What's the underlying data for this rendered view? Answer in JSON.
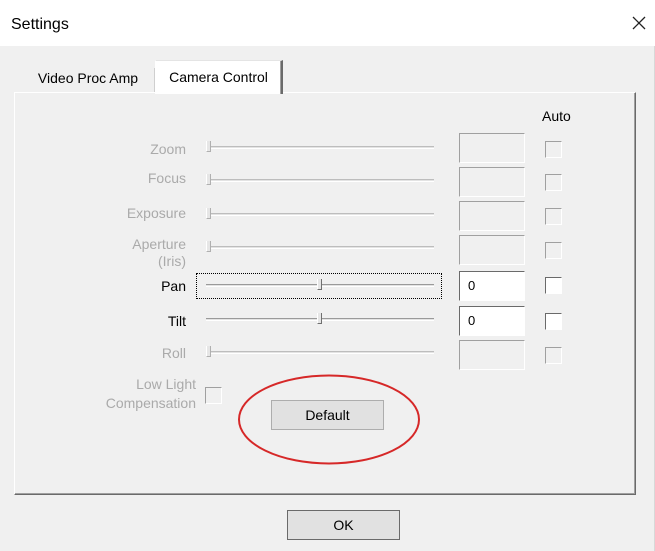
{
  "window": {
    "title": "Settings"
  },
  "tabs": [
    {
      "label": "Video Proc Amp",
      "active": false
    },
    {
      "label": "Camera Control",
      "active": true
    }
  ],
  "auto_header": "Auto",
  "controls": [
    {
      "name": "zoom",
      "label": "Zoom",
      "enabled": false,
      "slider": 0.0,
      "value": "",
      "auto": false
    },
    {
      "name": "focus",
      "label": "Focus",
      "enabled": false,
      "slider": 0.0,
      "value": "",
      "auto": false
    },
    {
      "name": "exposure",
      "label": "Exposure",
      "enabled": false,
      "slider": 0.0,
      "value": "",
      "auto": false
    },
    {
      "name": "aperture",
      "label": "Aperture (Iris)",
      "enabled": false,
      "slider": 0.0,
      "value": "",
      "auto": false
    },
    {
      "name": "pan",
      "label": "Pan",
      "enabled": true,
      "slider": 0.5,
      "value": "0",
      "auto": false
    },
    {
      "name": "tilt",
      "label": "Tilt",
      "enabled": true,
      "slider": 0.5,
      "value": "0",
      "auto": false
    },
    {
      "name": "roll",
      "label": "Roll",
      "enabled": false,
      "slider": 0.0,
      "value": "",
      "auto": false
    }
  ],
  "low_light": {
    "label": "Low Light Compensation",
    "checked": false
  },
  "buttons": {
    "default": "Default",
    "ok": "OK"
  },
  "colors": {
    "annotation": "#d62828",
    "disabled_text": "#aaaaaa"
  }
}
